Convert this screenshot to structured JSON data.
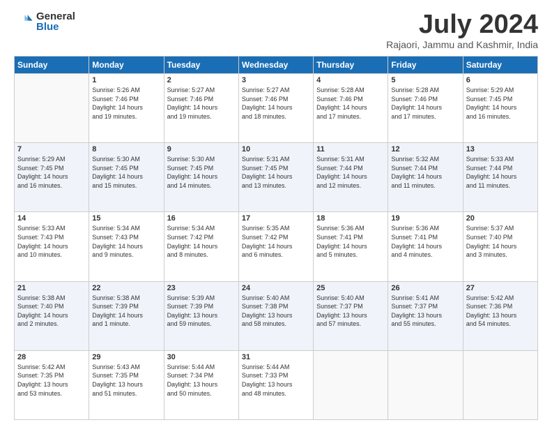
{
  "logo": {
    "general": "General",
    "blue": "Blue"
  },
  "title": "July 2024",
  "location": "Rajaori, Jammu and Kashmir, India",
  "weekdays": [
    "Sunday",
    "Monday",
    "Tuesday",
    "Wednesday",
    "Thursday",
    "Friday",
    "Saturday"
  ],
  "weeks": [
    [
      {
        "day": "",
        "info": ""
      },
      {
        "day": "1",
        "info": "Sunrise: 5:26 AM\nSunset: 7:46 PM\nDaylight: 14 hours\nand 19 minutes."
      },
      {
        "day": "2",
        "info": "Sunrise: 5:27 AM\nSunset: 7:46 PM\nDaylight: 14 hours\nand 19 minutes."
      },
      {
        "day": "3",
        "info": "Sunrise: 5:27 AM\nSunset: 7:46 PM\nDaylight: 14 hours\nand 18 minutes."
      },
      {
        "day": "4",
        "info": "Sunrise: 5:28 AM\nSunset: 7:46 PM\nDaylight: 14 hours\nand 17 minutes."
      },
      {
        "day": "5",
        "info": "Sunrise: 5:28 AM\nSunset: 7:46 PM\nDaylight: 14 hours\nand 17 minutes."
      },
      {
        "day": "6",
        "info": "Sunrise: 5:29 AM\nSunset: 7:45 PM\nDaylight: 14 hours\nand 16 minutes."
      }
    ],
    [
      {
        "day": "7",
        "info": "Sunrise: 5:29 AM\nSunset: 7:45 PM\nDaylight: 14 hours\nand 16 minutes."
      },
      {
        "day": "8",
        "info": "Sunrise: 5:30 AM\nSunset: 7:45 PM\nDaylight: 14 hours\nand 15 minutes."
      },
      {
        "day": "9",
        "info": "Sunrise: 5:30 AM\nSunset: 7:45 PM\nDaylight: 14 hours\nand 14 minutes."
      },
      {
        "day": "10",
        "info": "Sunrise: 5:31 AM\nSunset: 7:45 PM\nDaylight: 14 hours\nand 13 minutes."
      },
      {
        "day": "11",
        "info": "Sunrise: 5:31 AM\nSunset: 7:44 PM\nDaylight: 14 hours\nand 12 minutes."
      },
      {
        "day": "12",
        "info": "Sunrise: 5:32 AM\nSunset: 7:44 PM\nDaylight: 14 hours\nand 11 minutes."
      },
      {
        "day": "13",
        "info": "Sunrise: 5:33 AM\nSunset: 7:44 PM\nDaylight: 14 hours\nand 11 minutes."
      }
    ],
    [
      {
        "day": "14",
        "info": "Sunrise: 5:33 AM\nSunset: 7:43 PM\nDaylight: 14 hours\nand 10 minutes."
      },
      {
        "day": "15",
        "info": "Sunrise: 5:34 AM\nSunset: 7:43 PM\nDaylight: 14 hours\nand 9 minutes."
      },
      {
        "day": "16",
        "info": "Sunrise: 5:34 AM\nSunset: 7:42 PM\nDaylight: 14 hours\nand 8 minutes."
      },
      {
        "day": "17",
        "info": "Sunrise: 5:35 AM\nSunset: 7:42 PM\nDaylight: 14 hours\nand 6 minutes."
      },
      {
        "day": "18",
        "info": "Sunrise: 5:36 AM\nSunset: 7:41 PM\nDaylight: 14 hours\nand 5 minutes."
      },
      {
        "day": "19",
        "info": "Sunrise: 5:36 AM\nSunset: 7:41 PM\nDaylight: 14 hours\nand 4 minutes."
      },
      {
        "day": "20",
        "info": "Sunrise: 5:37 AM\nSunset: 7:40 PM\nDaylight: 14 hours\nand 3 minutes."
      }
    ],
    [
      {
        "day": "21",
        "info": "Sunrise: 5:38 AM\nSunset: 7:40 PM\nDaylight: 14 hours\nand 2 minutes."
      },
      {
        "day": "22",
        "info": "Sunrise: 5:38 AM\nSunset: 7:39 PM\nDaylight: 14 hours\nand 1 minute."
      },
      {
        "day": "23",
        "info": "Sunrise: 5:39 AM\nSunset: 7:39 PM\nDaylight: 13 hours\nand 59 minutes."
      },
      {
        "day": "24",
        "info": "Sunrise: 5:40 AM\nSunset: 7:38 PM\nDaylight: 13 hours\nand 58 minutes."
      },
      {
        "day": "25",
        "info": "Sunrise: 5:40 AM\nSunset: 7:37 PM\nDaylight: 13 hours\nand 57 minutes."
      },
      {
        "day": "26",
        "info": "Sunrise: 5:41 AM\nSunset: 7:37 PM\nDaylight: 13 hours\nand 55 minutes."
      },
      {
        "day": "27",
        "info": "Sunrise: 5:42 AM\nSunset: 7:36 PM\nDaylight: 13 hours\nand 54 minutes."
      }
    ],
    [
      {
        "day": "28",
        "info": "Sunrise: 5:42 AM\nSunset: 7:35 PM\nDaylight: 13 hours\nand 53 minutes."
      },
      {
        "day": "29",
        "info": "Sunrise: 5:43 AM\nSunset: 7:35 PM\nDaylight: 13 hours\nand 51 minutes."
      },
      {
        "day": "30",
        "info": "Sunrise: 5:44 AM\nSunset: 7:34 PM\nDaylight: 13 hours\nand 50 minutes."
      },
      {
        "day": "31",
        "info": "Sunrise: 5:44 AM\nSunset: 7:33 PM\nDaylight: 13 hours\nand 48 minutes."
      },
      {
        "day": "",
        "info": ""
      },
      {
        "day": "",
        "info": ""
      },
      {
        "day": "",
        "info": ""
      }
    ]
  ]
}
